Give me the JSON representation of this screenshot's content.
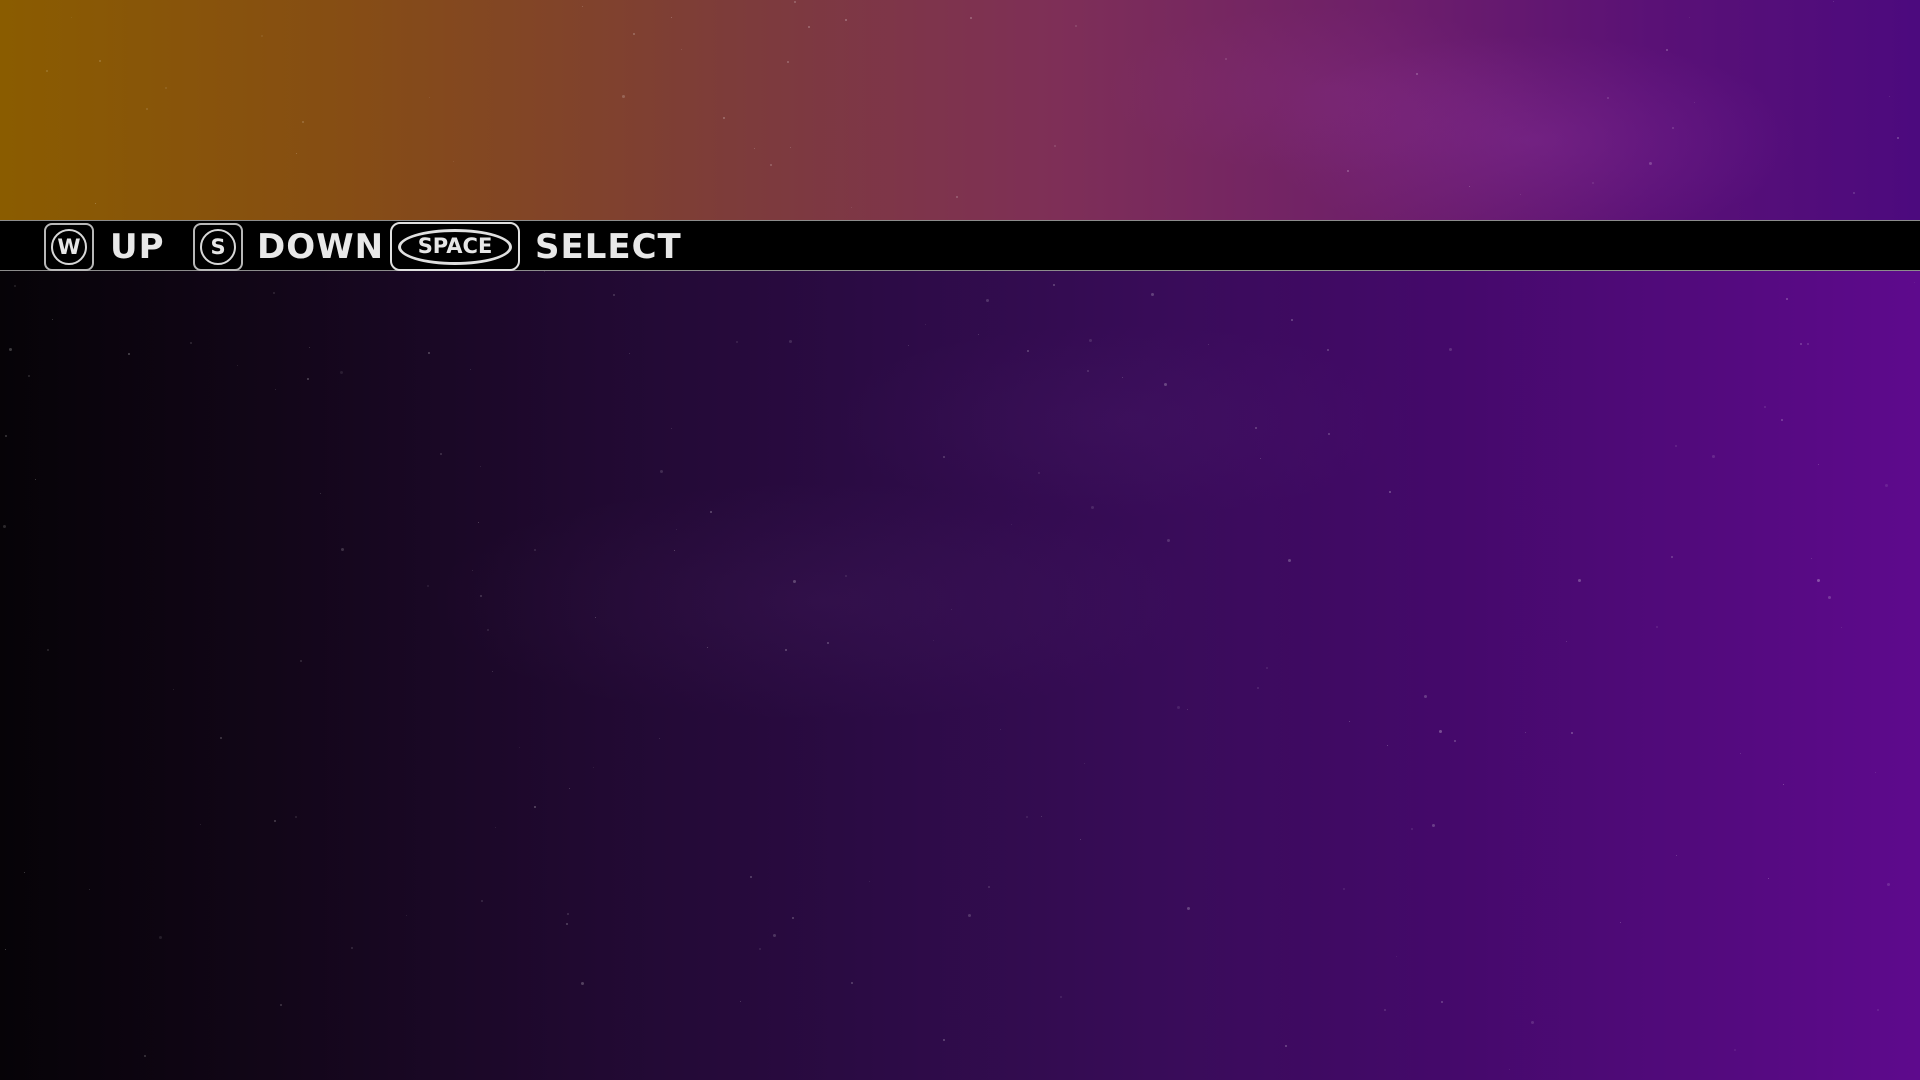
{
  "controls": {
    "up": {
      "key": "W",
      "label": "UP"
    },
    "down": {
      "key": "S",
      "label": "DOWN"
    },
    "select": {
      "key": "SPACE",
      "label": "SELECT"
    }
  },
  "colors": {
    "bar_background": "#000000",
    "text": "#e8e8e8",
    "top_left": "#8a5c00",
    "top_right": "#4c0a7e",
    "bottom_left": "#060307",
    "bottom_right": "#5e0a8d"
  }
}
